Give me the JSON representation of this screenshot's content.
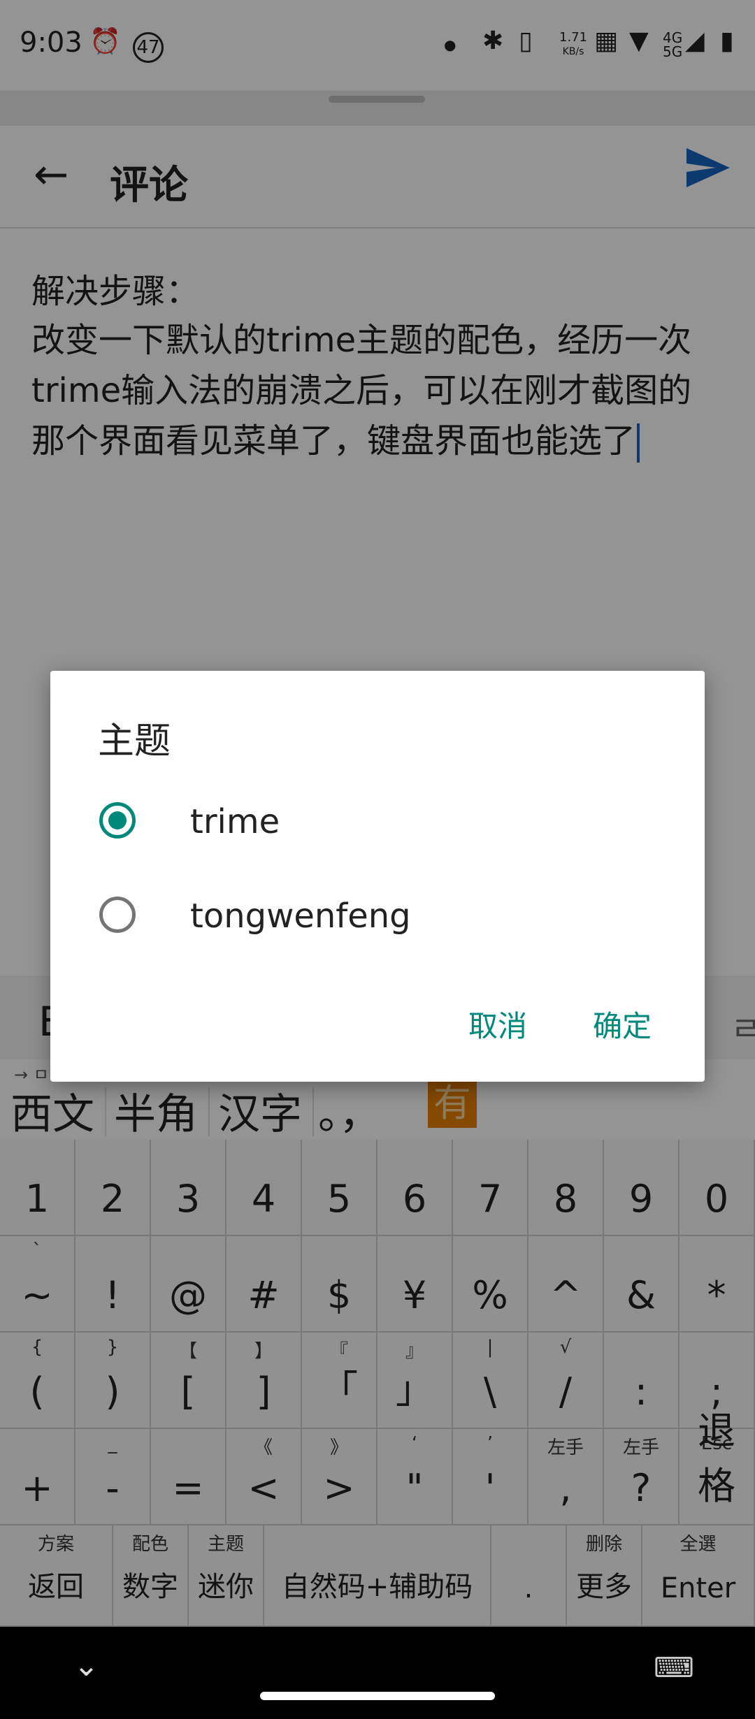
{
  "status_bar": {
    "time": "9:03",
    "notif_count": "47",
    "net_speed": "1.71",
    "net_unit": "KB/s",
    "network_top": "4G",
    "network_bottom": "5G"
  },
  "app_bar": {
    "title": "评论"
  },
  "editor": {
    "lines": [
      "解决步骤：",
      "改变一下默认的trime主题的配色，经历一次",
      "trime输入法的崩溃之后，可以在刚才截图的",
      "那个界面看见菜单了，键盘界面也能选了"
    ]
  },
  "dialog": {
    "title": "主题",
    "options": [
      {
        "label": "trime",
        "selected": true
      },
      {
        "label": "tongwenfeng",
        "selected": false
      }
    ],
    "cancel_label": "取消",
    "ok_label": "确定"
  },
  "keyboard": {
    "toolbar_left": "E",
    "toolbar_right": "ㄹ",
    "candidate_hint": "→ ㅁ",
    "candidates": [
      "西文",
      "半角",
      "汉字",
      "。，",
      "有"
    ],
    "rows": [
      [
        {
          "m": "1"
        },
        {
          "m": "2"
        },
        {
          "m": "3"
        },
        {
          "m": "4"
        },
        {
          "m": "5"
        },
        {
          "m": "6"
        },
        {
          "m": "7"
        },
        {
          "m": "8"
        },
        {
          "m": "9"
        },
        {
          "m": "0"
        }
      ],
      [
        {
          "m": "~",
          "s": "`"
        },
        {
          "m": "!"
        },
        {
          "m": "@"
        },
        {
          "m": "#"
        },
        {
          "m": "$"
        },
        {
          "m": "¥"
        },
        {
          "m": "%"
        },
        {
          "m": "^"
        },
        {
          "m": "&"
        },
        {
          "m": "*"
        }
      ],
      [
        {
          "m": "(",
          "s": "{"
        },
        {
          "m": ")",
          "s": "}"
        },
        {
          "m": "[",
          "s": "【"
        },
        {
          "m": "]",
          "s": "】"
        },
        {
          "m": "「",
          "s": "『"
        },
        {
          "m": "」",
          "s": "』"
        },
        {
          "m": "\\",
          "s": "|"
        },
        {
          "m": "/",
          "s": "√"
        },
        {
          "m": ":"
        },
        {
          "m": ";"
        }
      ],
      [
        {
          "m": "+"
        },
        {
          "m": "-",
          "s": "_"
        },
        {
          "m": "="
        },
        {
          "m": "<",
          "s": "《"
        },
        {
          "m": ">",
          "s": "》"
        },
        {
          "m": "\"",
          "s": "‘"
        },
        {
          "m": "'",
          "s": "’"
        },
        {
          "m": ",",
          "s": "左手"
        },
        {
          "m": "?",
          "s": "左手"
        },
        {
          "m": "退格",
          "s": "Esc"
        }
      ]
    ],
    "bottom_row": [
      {
        "m": "返回",
        "s": "方案"
      },
      {
        "m": "数字",
        "s": "配色"
      },
      {
        "m": "迷你",
        "s": "主题"
      },
      {
        "m": "自然码+辅助码"
      },
      {
        "m": "."
      },
      {
        "m": "更多",
        "s": "删除"
      },
      {
        "m": "Enter",
        "s": "全選"
      }
    ]
  },
  "colors": {
    "accent": "#00897b",
    "send": "#1565c0",
    "candidate_highlight": "#e67e00"
  },
  "icons": [
    "back-arrow-icon",
    "send-icon",
    "radio-selected-icon",
    "radio-unselected-icon",
    "chevron-down-icon",
    "keyboard-icon"
  ]
}
